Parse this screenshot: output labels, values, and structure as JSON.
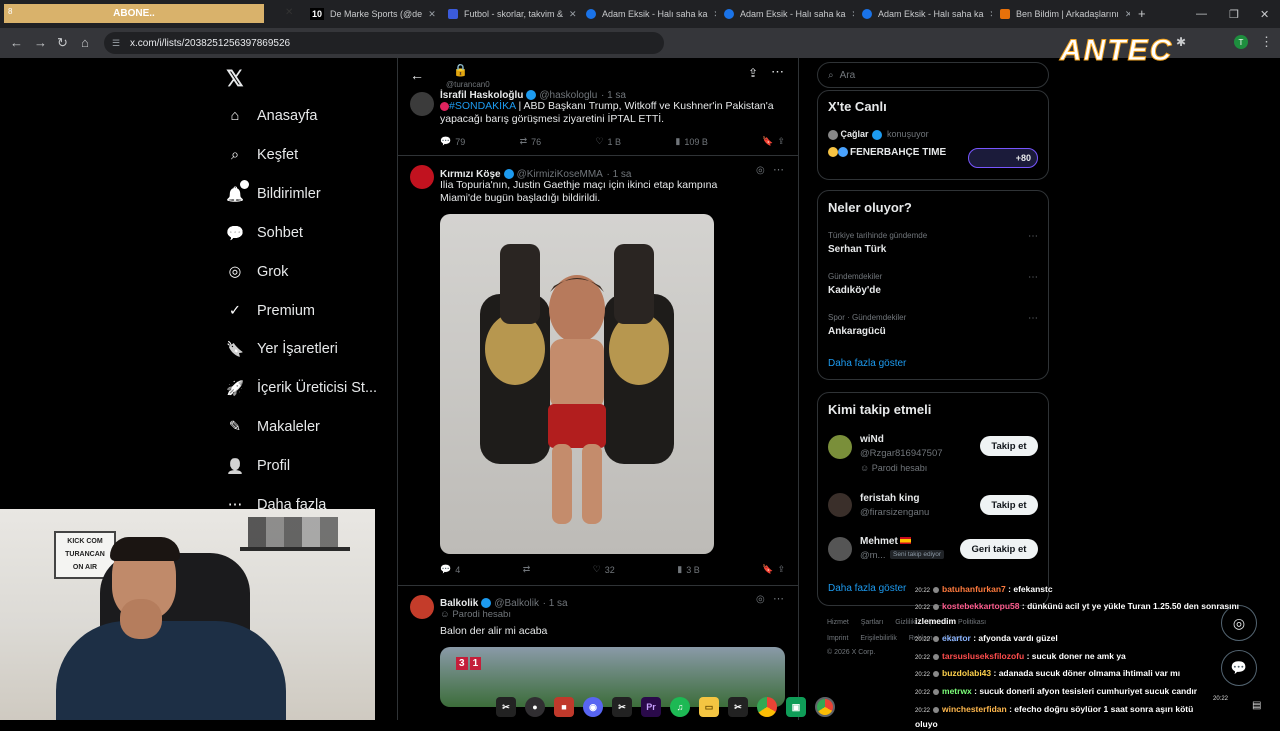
{
  "browser": {
    "tabs": [
      {
        "label": "ABONE..",
        "number": "8"
      },
      {
        "label": "De Marke Sports (@de",
        "number": "10"
      },
      {
        "label": "Futbol - skorlar, takvim &"
      },
      {
        "label": "Adam Eksik - Halı saha ka"
      },
      {
        "label": "Adam Eksik - Halı saha ka"
      },
      {
        "label": "Adam Eksik - Halı saha ka"
      },
      {
        "label": "Ben Bildim | Arkadaşlarını"
      }
    ],
    "url": "x.com/i/lists/2038251256397869526",
    "brand": "ANTEC"
  },
  "nav": {
    "items": [
      {
        "label": "Anasayfa",
        "icon": "home-icon"
      },
      {
        "label": "Keşfet",
        "icon": "search-icon"
      },
      {
        "label": "Bildirimler",
        "icon": "bell-icon"
      },
      {
        "label": "Sohbet",
        "icon": "chat-icon"
      },
      {
        "label": "Grok",
        "icon": "grok-icon"
      },
      {
        "label": "Premium",
        "icon": "premium-icon"
      },
      {
        "label": "Yer İşaretleri",
        "icon": "bookmark-icon"
      },
      {
        "label": "İçerik Üreticisi St...",
        "icon": "rocket-icon"
      },
      {
        "label": "Makaleler",
        "icon": "article-icon"
      },
      {
        "label": "Profil",
        "icon": "profile-icon"
      },
      {
        "label": "Daha fazla",
        "icon": "more-icon"
      }
    ]
  },
  "timeline": {
    "header_handle": "@turancan0",
    "tweets": [
      {
        "name": "İsrafil Haskoloğlu",
        "handle": "@haskologlu",
        "time": "1 sa",
        "hashtag": "#SONDAKİKA",
        "text": "| ABD Başkanı Trump, Witkoff ve Kushner'in Pakistan'a yapacağı barış görüşmesi ziyaretini İPTAL ETTİ.",
        "replies": "79",
        "reposts": "76",
        "likes": "1 B",
        "views": "109 B"
      },
      {
        "name": "Kırmızı Köşe",
        "handle": "@KirmiziKoseMMA",
        "time": "1 sa",
        "text": "Ilia Topuria'nın, Justin Gaethje maçı için ikinci etap kampına Miami'de bugün başladığı bildirildi.",
        "replies": "4",
        "likes": "32",
        "views": "3 B"
      },
      {
        "name": "Balkolik",
        "handle": "@Balkolik",
        "time": "1 sa",
        "label": "Parodi hesabı",
        "text": "Balon der alir mi acaba",
        "score_home": "3",
        "score_away": "1"
      }
    ]
  },
  "right": {
    "search_placeholder": "Ara",
    "live": {
      "title": "X'te Canlı",
      "host": "Çağlar",
      "status": "konuşuyor",
      "space_title": "FENERBAHÇE TIME",
      "listeners": "+80"
    },
    "trends": {
      "title": "Neler oluyor?",
      "items": [
        {
          "meta": "Türkiye tarihinde gündemde",
          "name": "Serhan Türk"
        },
        {
          "meta": "Gündemdekiler",
          "name": "Kadıköy'de"
        },
        {
          "meta": "Spor · Gündemdekiler",
          "name": "Ankaragücü"
        }
      ],
      "more": "Daha fazla göster"
    },
    "follow": {
      "title": "Kimi takip etmeli",
      "items": [
        {
          "name": "wiNd",
          "handle": "@Rzgar816947507",
          "sub": "Parodi hesabı",
          "button": "Takip et"
        },
        {
          "name": "feristah king",
          "handle": "@firarsizenganu",
          "sub": "",
          "button": "Takip et"
        },
        {
          "name": "Mehmet",
          "handle": "@m...",
          "sub": "Seni takip ediyor",
          "button": "Geri takip et"
        }
      ],
      "more": "Daha fazla göster"
    },
    "footer": {
      "line1": [
        "Hizmet Şartları",
        "Gizlilik",
        "Çerez Politikası"
      ],
      "line2": [
        "Imprint",
        "Erişilebilirlik",
        "Reklam bilgisi"
      ],
      "copyright": "© 2026 X Corp."
    }
  },
  "webcam": {
    "sign": [
      "KICK COM",
      "TURANCAN",
      "ON AIR"
    ]
  },
  "chat": [
    {
      "time": "20:22",
      "user": "batuhanfurkan7",
      "color": "#ff7a3d",
      "msg": "efekanstc"
    },
    {
      "time": "20:22",
      "user": "kostebekkartopu58",
      "color": "#ff5d8f",
      "msg": "dünkünü acil yt ye yükle Turan 1.25.50 den sonrasını izlemedim"
    },
    {
      "time": "20:22",
      "user": "ekartor",
      "color": "#8ab4ff",
      "msg": "afyonda vardı güzel"
    },
    {
      "time": "20:22",
      "user": "tarsusluseksfilozofu",
      "color": "#ff4d4d",
      "msg": "sucuk doner ne amk ya"
    },
    {
      "time": "20:22",
      "user": "buzdolabi43",
      "color": "#ffd24d",
      "msg": "adanada sucuk döner olmama ihtimali var mı"
    },
    {
      "time": "20:22",
      "user": "metrwx",
      "color": "#7dff7a",
      "msg": "sucuk donerli afyon tesisleri cumhuriyet sucuk candır"
    },
    {
      "time": "20:22",
      "user": "winchesterfidan",
      "color": "#ffb84d",
      "msg": "efecho doğru söylüor 1 saat sonra aşırı kötü oluyo"
    }
  ],
  "taskbar": {
    "clock": "20:22"
  }
}
